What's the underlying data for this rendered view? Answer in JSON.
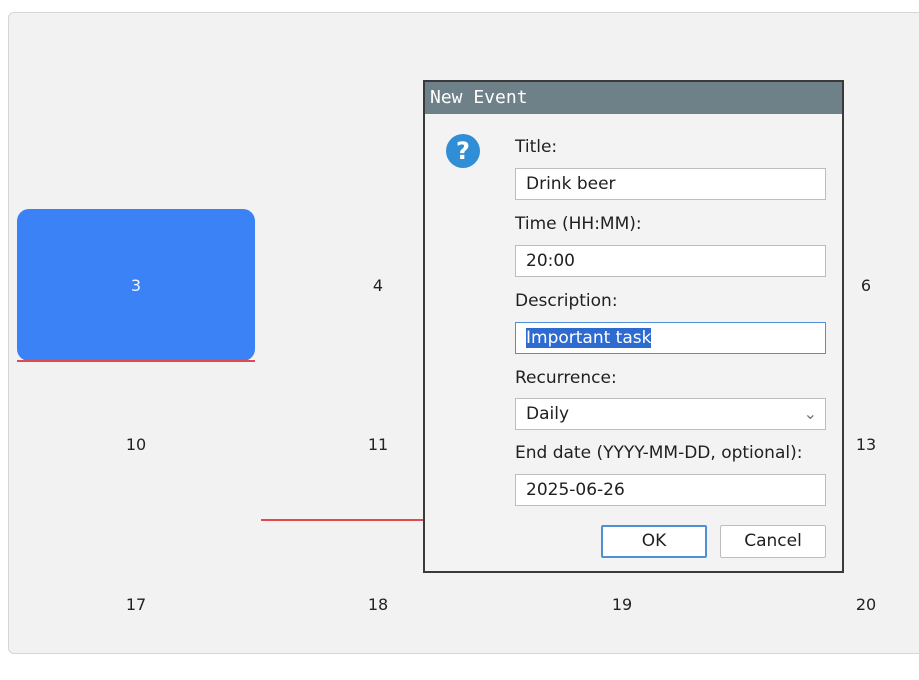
{
  "calendar": {
    "days": {
      "d3": "3",
      "d4": "4",
      "d6": "6",
      "d10": "10",
      "d11": "11",
      "d13": "13",
      "d17": "17",
      "d18": "18",
      "d19": "19",
      "d20": "20"
    },
    "colors": {
      "selected_cell": "#3b82f6",
      "event_line": "#e14b4b"
    }
  },
  "dialog": {
    "title": "New Event",
    "icon": "question-icon",
    "title_label": "Title:",
    "title_value": "Drink beer",
    "time_label": "Time (HH:MM):",
    "time_value": "20:00",
    "description_label": "Description:",
    "description_value": "Important task",
    "recurrence_label": "Recurrence:",
    "recurrence_value": "Daily",
    "end_date_label": "End date (YYYY-MM-DD, optional):",
    "end_date_value": "2025-06-26",
    "ok_label": "OK",
    "cancel_label": "Cancel"
  }
}
